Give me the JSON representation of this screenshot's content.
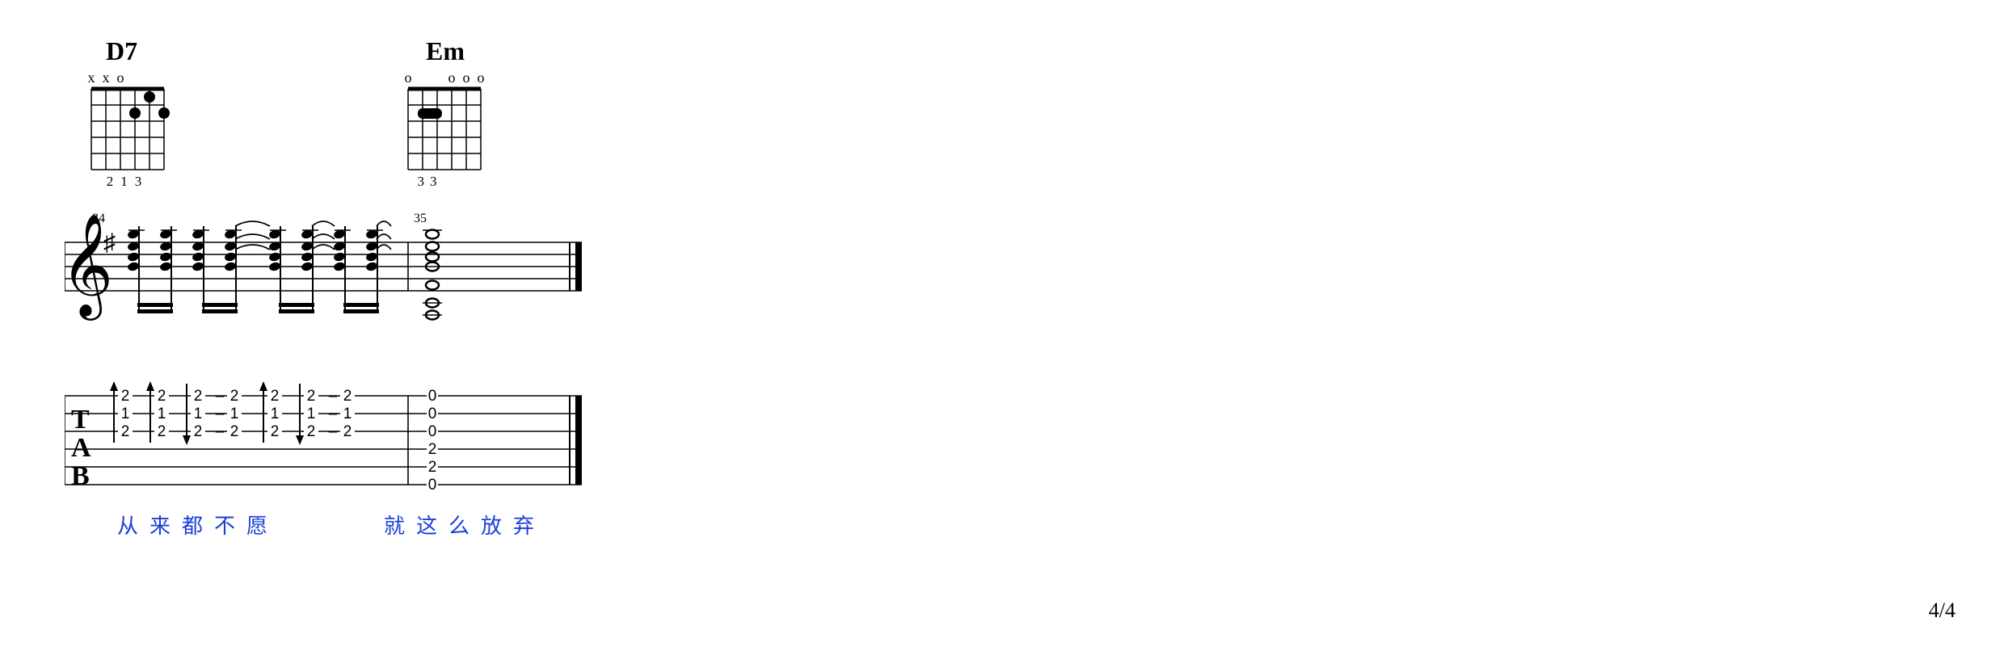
{
  "page": "4/4",
  "chords": [
    {
      "name": "D7",
      "fingering": "213",
      "top_marks": [
        "x",
        "x",
        "o",
        "",
        "",
        ""
      ]
    },
    {
      "name": "Em",
      "fingering": "33",
      "top_marks": [
        "o",
        "",
        "",
        "o",
        "o",
        "o"
      ]
    }
  ],
  "measures": {
    "m1": {
      "number": "34"
    },
    "m2": {
      "number": "35"
    }
  },
  "tab_label": {
    "t": "T",
    "a": "A",
    "b": "B"
  },
  "lyrics": {
    "line1": {
      "c1": "从",
      "c2": "来",
      "c3": "都",
      "c4": "不",
      "c5": "愿"
    },
    "line2": {
      "c1": "就",
      "c2": "这",
      "c3": "么",
      "c4": "放",
      "c5": "弃"
    }
  },
  "chart_data": {
    "type": "table",
    "description": "Guitar tablature excerpt with two measures preceded by chord diagrams D7 and Em and followed by Chinese lyrics.",
    "chord_diagrams": [
      {
        "name": "D7",
        "strings": [
          {
            "string": 6,
            "top_mark": "x"
          },
          {
            "string": 5,
            "top_mark": "x"
          },
          {
            "string": 4,
            "top_mark": "o"
          },
          {
            "string": 3,
            "fret": 2,
            "finger": 2
          },
          {
            "string": 2,
            "fret": 1,
            "finger": 1
          },
          {
            "string": 1,
            "fret": 2,
            "finger": 3
          }
        ]
      },
      {
        "name": "Em",
        "strings": [
          {
            "string": 6,
            "top_mark": "o"
          },
          {
            "string": 5,
            "fret": 2,
            "finger": 3
          },
          {
            "string": 4,
            "fret": 2,
            "finger": 3
          },
          {
            "string": 3,
            "top_mark": "o"
          },
          {
            "string": 2,
            "top_mark": "o"
          },
          {
            "string": 1,
            "top_mark": "o"
          }
        ],
        "barre": {
          "fret": 2,
          "from_string": 5,
          "to_string": 4
        }
      }
    ],
    "clef": "treble",
    "key_signature": "1_sharp",
    "measures": [
      {
        "number": 34,
        "chord": "D7",
        "strum_events": [
          {
            "direction": "down",
            "frets": {
              "1": 2,
              "2": 1,
              "3": 2
            }
          },
          {
            "direction": "down",
            "frets": {
              "1": 2,
              "2": 1,
              "3": 2
            }
          },
          {
            "direction": "up",
            "frets": {
              "1": 2,
              "2": 1,
              "3": 2
            }
          },
          {
            "tie": "hold",
            "frets": {
              "1": 2,
              "2": 1,
              "3": 2
            }
          },
          {
            "direction": "down",
            "frets": {
              "1": 2,
              "2": 1,
              "3": 2
            }
          },
          {
            "direction": "up",
            "frets": {
              "1": 2,
              "2": 1,
              "3": 2
            }
          },
          {
            "tie": "hold",
            "frets": {
              "1": 2,
              "2": 1,
              "3": 2
            }
          }
        ],
        "lyrics": "从来都不愿"
      },
      {
        "number": 35,
        "chord": "Em",
        "events": [
          {
            "type": "whole_chord",
            "frets": {
              "1": 0,
              "2": 0,
              "3": 0,
              "4": 2,
              "5": 2,
              "6": 0
            }
          }
        ],
        "lyrics": "就这么放弃"
      }
    ]
  }
}
